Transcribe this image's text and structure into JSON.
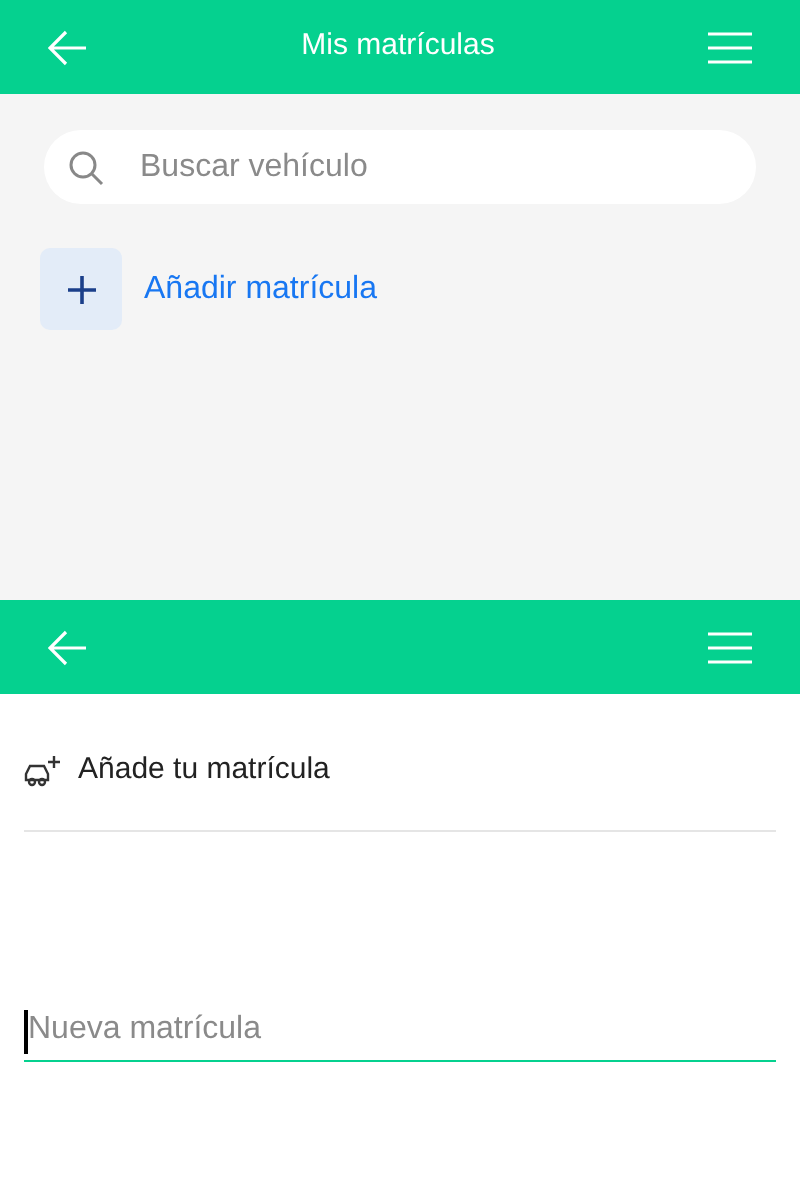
{
  "screen_1": {
    "header": {
      "title": "Mis matrículas"
    },
    "search": {
      "placeholder": "Buscar vehículo"
    },
    "add_button": {
      "label": "Añadir matrícula"
    }
  },
  "screen_2": {
    "section": {
      "label": "Añade tu matrícula"
    },
    "plate_field": {
      "placeholder": "Nueva matrícula",
      "focused": true
    }
  }
}
